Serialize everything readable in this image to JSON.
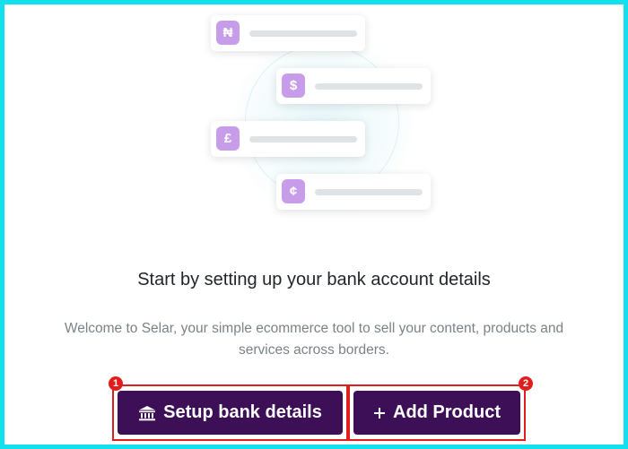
{
  "illustration": {
    "currencies": [
      {
        "symbol": "₦",
        "icon": "naira-icon"
      },
      {
        "symbol": "$",
        "icon": "dollar-icon"
      },
      {
        "symbol": "£",
        "icon": "pound-icon"
      },
      {
        "symbol": "¢",
        "icon": "cedi-icon"
      }
    ],
    "badge_color": "#c79de9"
  },
  "content": {
    "headline": "Start by setting up your bank account details",
    "subtext": "Welcome to Selar, your simple ecommerce tool to sell your content, products and services across borders."
  },
  "actions": {
    "setup_bank": {
      "label": "Setup bank details",
      "marker": "1",
      "icon": "bank-icon"
    },
    "add_product": {
      "label": "Add Product",
      "marker": "2",
      "icon": "plus-icon"
    }
  },
  "colors": {
    "primary": "#3c0f56",
    "frame": "#12e0ee",
    "highlight": "#e01e1e"
  }
}
